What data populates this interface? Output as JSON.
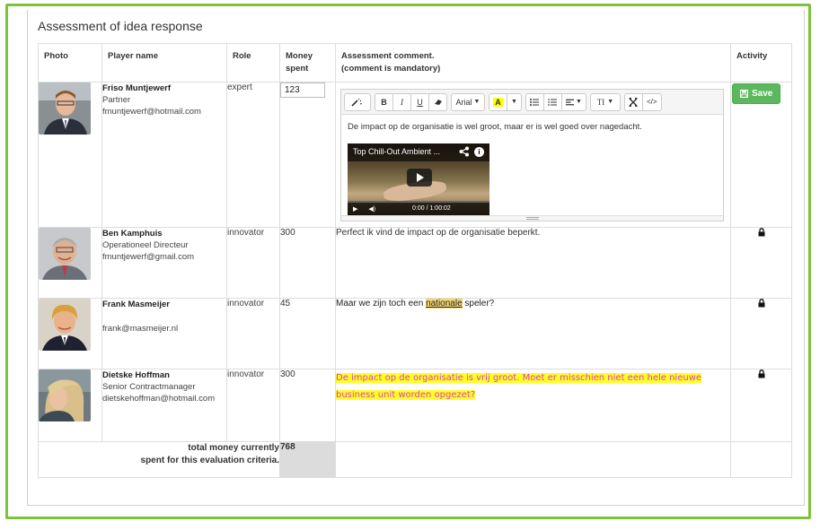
{
  "panel": {
    "title": "Assessment of idea response"
  },
  "table": {
    "headers": {
      "photo": "Photo",
      "player_name": "Player name",
      "role": "Role",
      "money_spent": "Money spent",
      "assessment_comment": "Assessment comment.",
      "assessment_note": "(comment is mandatory)",
      "activity": "Activity"
    },
    "rows": [
      {
        "name": "Friso Muntjewerf",
        "title": "Partner",
        "email": "fmuntjewerf@hotmail.com",
        "role": "expert",
        "money": "123",
        "comment": "De impact op de organisatie is wel groot, maar er is wel goed over nagedacht.",
        "activity": "Save"
      },
      {
        "name": "Ben Kamphuis",
        "title": "Operationeel Directeur",
        "email": "fmuntjewerf@gmail.com",
        "role": "innovator",
        "money": "300",
        "comment": "Perfect ik vind de impact op de organisatie beperkt."
      },
      {
        "name": "Frank Masmeijer",
        "title": "",
        "email": "frank@masmeijer.nl",
        "role": "innovator",
        "money": "45",
        "comment_before": "Maar we zijn toch een ",
        "comment_highlight": "nationale",
        "comment_after": " speler?"
      },
      {
        "name": "Dietske Hoffman",
        "title": "Senior Contractmanager",
        "email": "dietskehoffman@hotmail.com",
        "role": "innovator",
        "money": "300",
        "comment": "De impact op de organisatie is vrij groot. Moet er misschien niet een hele nieuwe business unit worden opgezet?"
      }
    ],
    "total": {
      "label_line1": "total money currently",
      "label_line2": "spent for this evaluation criteria.",
      "value": "768"
    }
  },
  "editor": {
    "toolbar": {
      "style_icon": "magic-wand-icon",
      "bold": "B",
      "italic": "I",
      "underline": "U",
      "eraser_icon": "eraser-icon",
      "font": "Arial",
      "color_letter": "A",
      "color_highlight": "#ffff00",
      "ul_icon": "unordered-list-icon",
      "ol_icon": "ordered-list-icon",
      "align_icon": "align-icon",
      "height_label": "TI",
      "fullscreen_icon": "fullscreen-icon",
      "code_icon": "code-icon"
    },
    "video": {
      "title": "Top Chill-Out Ambient ...",
      "time": "0:00 / 1:00:02"
    }
  },
  "colors": {
    "frame_green": "#7dc33a",
    "save_green": "#5cb85c",
    "handwritten_pink": "#e23ac8",
    "highlight_yellow": "#ffff24"
  }
}
